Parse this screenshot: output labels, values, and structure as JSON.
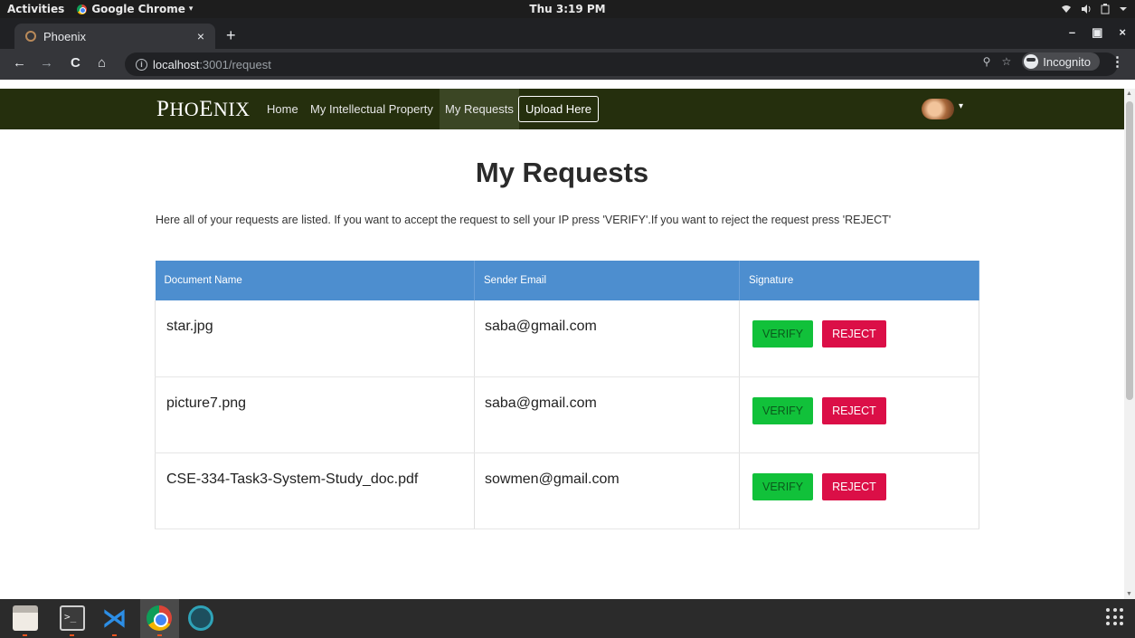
{
  "os_bar": {
    "activities": "Activities",
    "app_name": "Google Chrome",
    "app_caret": "▾",
    "clock": "Thu  3:19 PM",
    "tray_icons": [
      "wifi-icon",
      "volume-icon",
      "battery-icon",
      "system-menu-icon"
    ]
  },
  "browser": {
    "tab_title": "Phoenix",
    "tab_close": "×",
    "new_tab": "+",
    "window_controls": {
      "minimize": "–",
      "maximize": "▣",
      "close": "×"
    },
    "nav": {
      "back": "←",
      "forward": "→",
      "reload": "C",
      "home": "⌂"
    },
    "url_host": "localhost",
    "url_path": ":3001/request",
    "info_icon": "i",
    "zoom_icon": "⚲",
    "bookmark_icon": "☆",
    "incognito_label": "Incognito",
    "menu_icon": "⋮"
  },
  "navbar": {
    "brand_p": "P",
    "brand_ho": "HO",
    "brand_e": "E",
    "brand_nix": "NIX",
    "home": "Home",
    "my_ip": "My Intellectual Property",
    "my_requests": "My Requests",
    "upload": "Upload Here",
    "avatar_caret": "▾"
  },
  "page": {
    "title": "My Requests",
    "description": "Here all of your requests are listed. If you want to accept the request to sell your IP press 'VERIFY'.If you want to reject the request press 'REJECT'"
  },
  "table": {
    "headers": [
      "Document Name",
      "Sender Email",
      "Signature"
    ],
    "rows": [
      {
        "document": "star.jpg",
        "email": "saba@gmail.com",
        "verify": "VERIFY",
        "reject": "REJECT"
      },
      {
        "document": "picture7.png",
        "email": "saba@gmail.com",
        "verify": "VERIFY",
        "reject": "REJECT"
      },
      {
        "document": "CSE-334-Task3-System-Study_doc.pdf",
        "email": "sowmen@gmail.com",
        "verify": "VERIFY",
        "reject": "REJECT"
      }
    ]
  },
  "colors": {
    "navbar_bg": "#252f0d",
    "table_header_bg": "#4d8ecf",
    "verify_bg": "#11c13a",
    "reject_bg": "#db0f47"
  },
  "dock": {
    "terminal_prompt": ">_",
    "vscode_glyph": "⋊"
  }
}
